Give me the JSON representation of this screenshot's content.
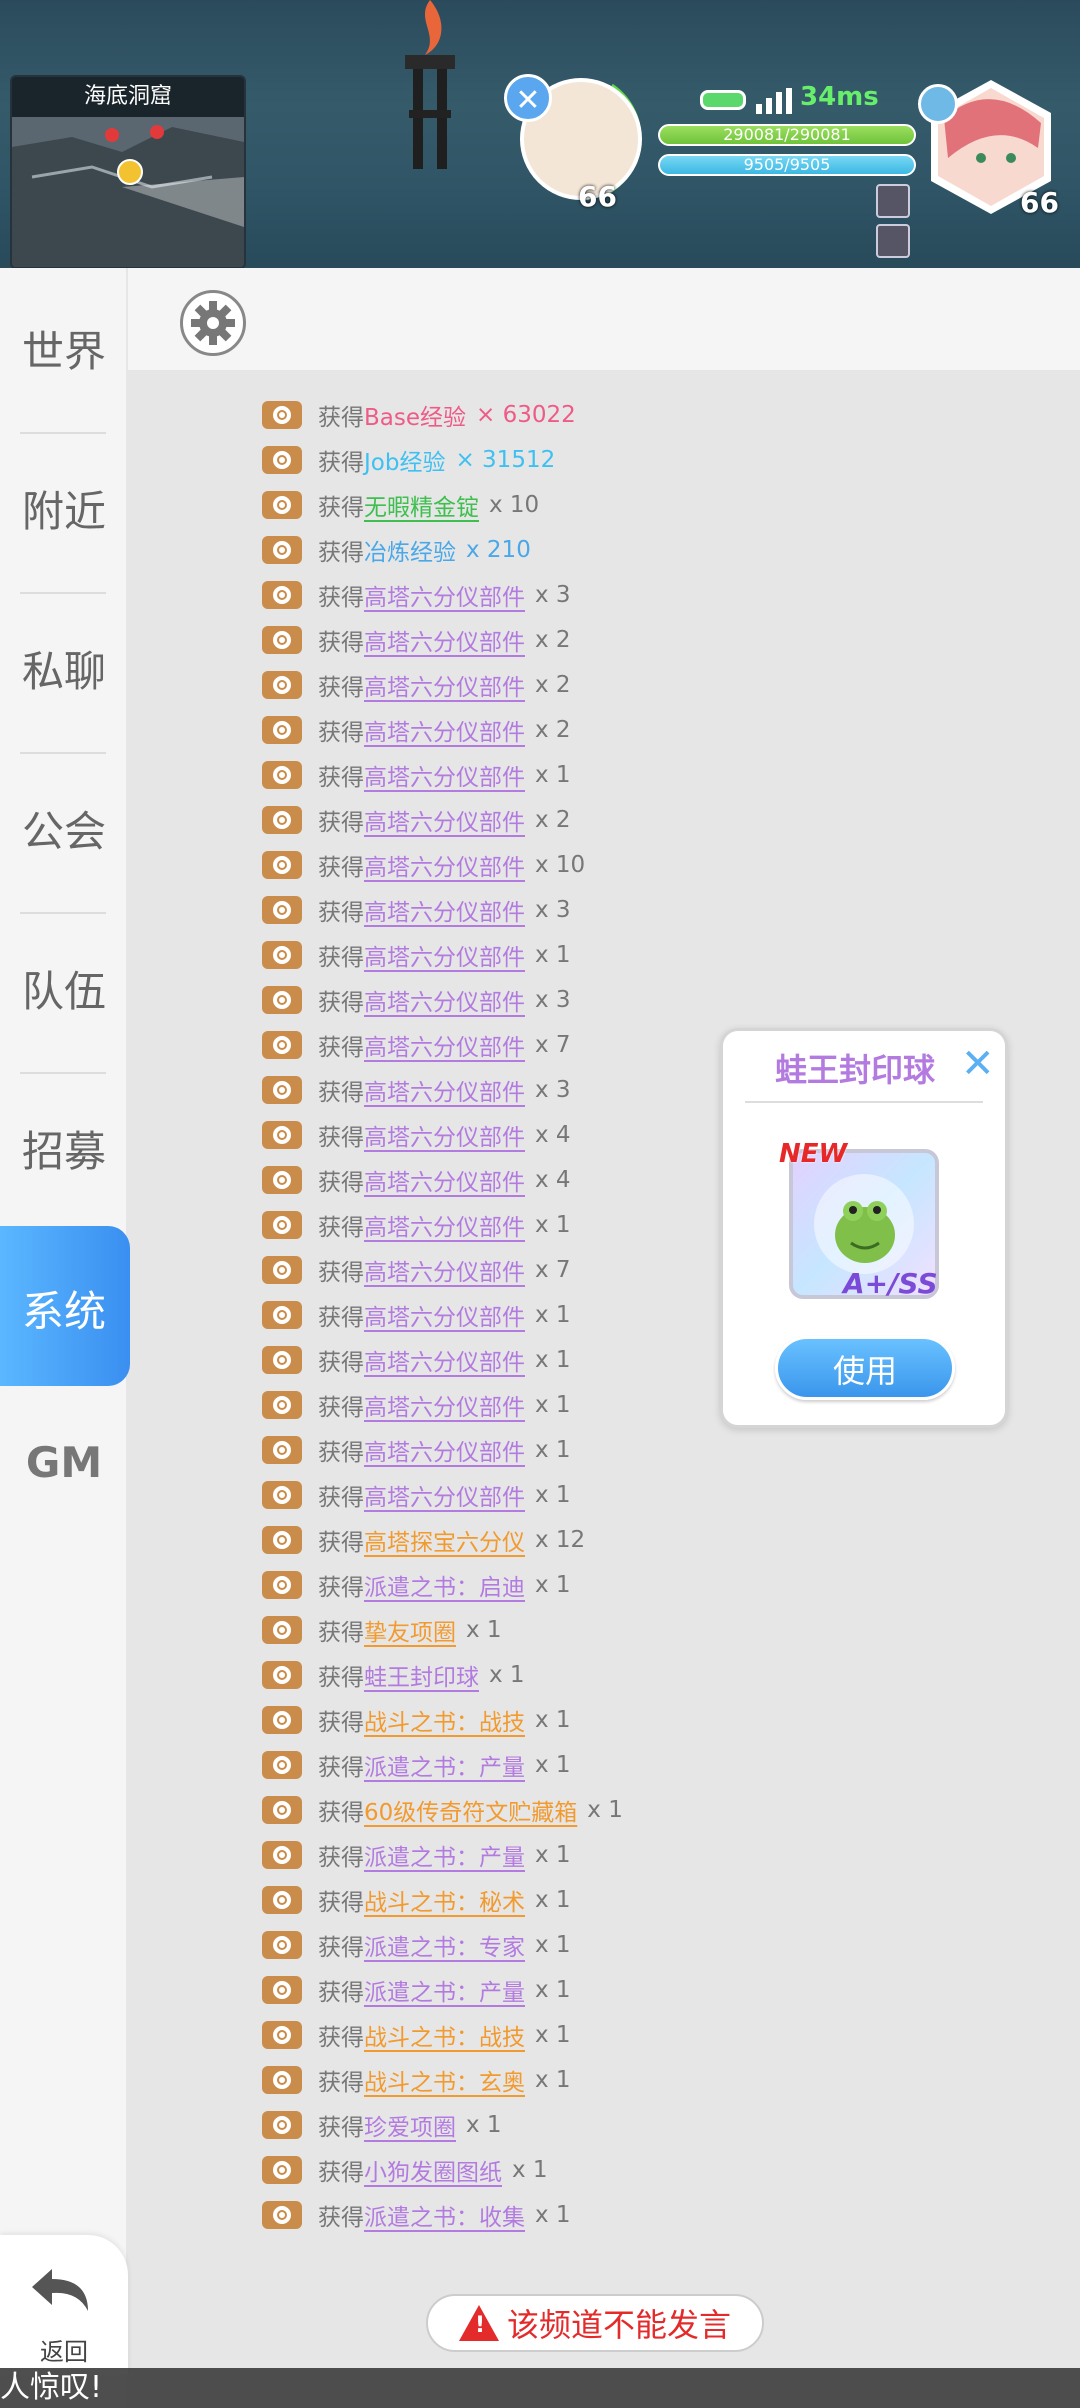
{
  "minimap": {
    "title": "海底洞窟"
  },
  "pet": {
    "level": "66",
    "close_icon": "close-icon"
  },
  "status": {
    "ping": "34ms",
    "hp": "290081/290081",
    "sp": "9505/9505"
  },
  "character": {
    "level": "66"
  },
  "nav": {
    "items": [
      "世界",
      "附近",
      "私聊",
      "公会",
      "队伍",
      "招募",
      "系统",
      "GM"
    ],
    "active": "系统",
    "back_label": "返回"
  },
  "colors": {
    "active_tab": "#3a8ff0",
    "orange": "#f29a2e",
    "purple": "#b37be0",
    "green": "#3fbf4f",
    "blue": "#4aa8e8",
    "pink": "#ee5b86",
    "cyan": "#3ec1f2"
  },
  "messages": [
    {
      "get": "获得",
      "item": "Base经验",
      "qty": "× 63022",
      "color": "#ee5b86",
      "underline": false
    },
    {
      "get": "获得",
      "item": "Job经验",
      "qty": "× 31512",
      "color": "#3ec1f2",
      "underline": false
    },
    {
      "get": "获得",
      "item": "无暇精金锭",
      "qty": "x 10",
      "color": "#3fbf4f",
      "underline": true
    },
    {
      "get": "获得",
      "item": "冶炼经验",
      "qty": "x 210",
      "color": "#4aa8e8",
      "underline": false
    },
    {
      "get": "获得",
      "item": "高塔六分仪部件",
      "qty": "x 3",
      "color": "#b37be0",
      "underline": true
    },
    {
      "get": "获得",
      "item": "高塔六分仪部件",
      "qty": "x 2",
      "color": "#b37be0",
      "underline": true
    },
    {
      "get": "获得",
      "item": "高塔六分仪部件",
      "qty": "x 2",
      "color": "#b37be0",
      "underline": true
    },
    {
      "get": "获得",
      "item": "高塔六分仪部件",
      "qty": "x 2",
      "color": "#b37be0",
      "underline": true
    },
    {
      "get": "获得",
      "item": "高塔六分仪部件",
      "qty": "x 1",
      "color": "#b37be0",
      "underline": true
    },
    {
      "get": "获得",
      "item": "高塔六分仪部件",
      "qty": "x 2",
      "color": "#b37be0",
      "underline": true
    },
    {
      "get": "获得",
      "item": "高塔六分仪部件",
      "qty": "x 10",
      "color": "#b37be0",
      "underline": true
    },
    {
      "get": "获得",
      "item": "高塔六分仪部件",
      "qty": "x 3",
      "color": "#b37be0",
      "underline": true
    },
    {
      "get": "获得",
      "item": "高塔六分仪部件",
      "qty": "x 1",
      "color": "#b37be0",
      "underline": true
    },
    {
      "get": "获得",
      "item": "高塔六分仪部件",
      "qty": "x 3",
      "color": "#b37be0",
      "underline": true
    },
    {
      "get": "获得",
      "item": "高塔六分仪部件",
      "qty": "x 7",
      "color": "#b37be0",
      "underline": true
    },
    {
      "get": "获得",
      "item": "高塔六分仪部件",
      "qty": "x 3",
      "color": "#b37be0",
      "underline": true
    },
    {
      "get": "获得",
      "item": "高塔六分仪部件",
      "qty": "x 4",
      "color": "#b37be0",
      "underline": true
    },
    {
      "get": "获得",
      "item": "高塔六分仪部件",
      "qty": "x 4",
      "color": "#b37be0",
      "underline": true
    },
    {
      "get": "获得",
      "item": "高塔六分仪部件",
      "qty": "x 1",
      "color": "#b37be0",
      "underline": true
    },
    {
      "get": "获得",
      "item": "高塔六分仪部件",
      "qty": "x 7",
      "color": "#b37be0",
      "underline": true
    },
    {
      "get": "获得",
      "item": "高塔六分仪部件",
      "qty": "x 1",
      "color": "#b37be0",
      "underline": true
    },
    {
      "get": "获得",
      "item": "高塔六分仪部件",
      "qty": "x 1",
      "color": "#b37be0",
      "underline": true
    },
    {
      "get": "获得",
      "item": "高塔六分仪部件",
      "qty": "x 1",
      "color": "#b37be0",
      "underline": true
    },
    {
      "get": "获得",
      "item": "高塔六分仪部件",
      "qty": "x 1",
      "color": "#b37be0",
      "underline": true
    },
    {
      "get": "获得",
      "item": "高塔六分仪部件",
      "qty": "x 1",
      "color": "#b37be0",
      "underline": true
    },
    {
      "get": "获得",
      "item": "高塔探宝六分仪",
      "qty": "x 12",
      "color": "#f29a2e",
      "underline": true
    },
    {
      "get": "获得",
      "item": "派遣之书：启迪",
      "qty": "x 1",
      "color": "#b37be0",
      "underline": true
    },
    {
      "get": "获得",
      "item": "挚友项圈",
      "qty": "x 1",
      "color": "#f29a2e",
      "underline": true
    },
    {
      "get": "获得",
      "item": "蛙王封印球",
      "qty": "x 1",
      "color": "#b37be0",
      "underline": true
    },
    {
      "get": "获得",
      "item": "战斗之书：战技",
      "qty": "x 1",
      "color": "#f29a2e",
      "underline": true
    },
    {
      "get": "获得",
      "item": "派遣之书：产量",
      "qty": "x 1",
      "color": "#b37be0",
      "underline": true
    },
    {
      "get": "获得",
      "item": "60级传奇符文贮藏箱",
      "qty": "x 1",
      "color": "#f29a2e",
      "underline": true
    },
    {
      "get": "获得",
      "item": "派遣之书：产量",
      "qty": "x 1",
      "color": "#b37be0",
      "underline": true
    },
    {
      "get": "获得",
      "item": "战斗之书：秘术",
      "qty": "x 1",
      "color": "#f29a2e",
      "underline": true
    },
    {
      "get": "获得",
      "item": "派遣之书：专家",
      "qty": "x 1",
      "color": "#b37be0",
      "underline": true
    },
    {
      "get": "获得",
      "item": "派遣之书：产量",
      "qty": "x 1",
      "color": "#b37be0",
      "underline": true
    },
    {
      "get": "获得",
      "item": "战斗之书：战技",
      "qty": "x 1",
      "color": "#f29a2e",
      "underline": true
    },
    {
      "get": "获得",
      "item": "战斗之书：玄奥",
      "qty": "x 1",
      "color": "#f29a2e",
      "underline": true
    },
    {
      "get": "获得",
      "item": "珍爱项圈",
      "qty": "x 1",
      "color": "#b37be0",
      "underline": true
    },
    {
      "get": "获得",
      "item": "小狗发圈图纸",
      "qty": "x 1",
      "color": "#b37be0",
      "underline": true
    },
    {
      "get": "获得",
      "item": "派遣之书：收集",
      "qty": "x 1",
      "color": "#b37be0",
      "underline": true
    }
  ],
  "popup": {
    "title": "蛙王封印球",
    "new_tag": "NEW",
    "grade": "A+/SS",
    "use_label": "使用"
  },
  "notice": "该频道不能发言",
  "ticker": "人惊叹!"
}
